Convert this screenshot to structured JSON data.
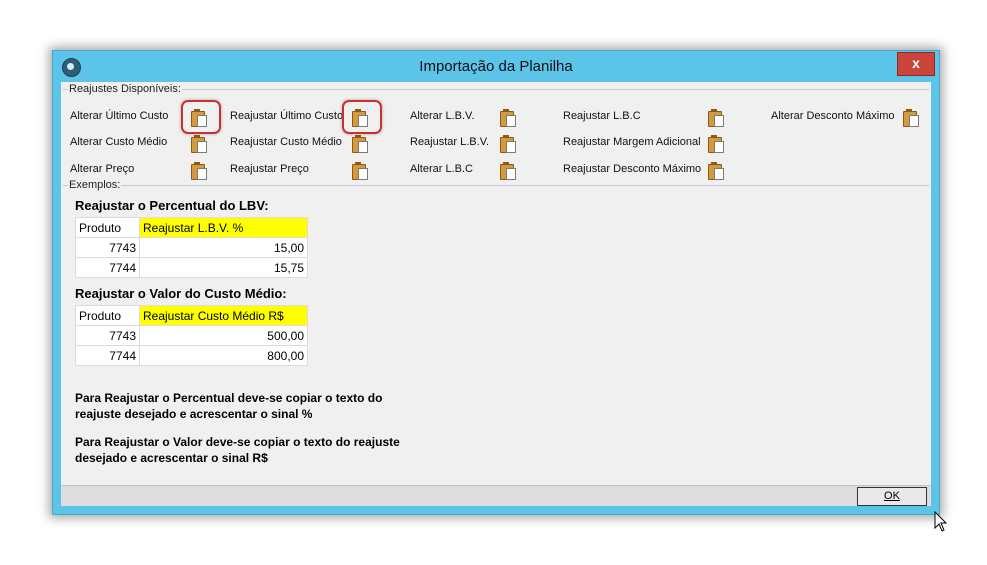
{
  "window": {
    "title": "Importação da Planilha",
    "close_label": "x"
  },
  "reajustes": {
    "legend": "Reajustes Disponíveis:",
    "items": [
      [
        "Alterar Último Custo",
        "Reajustar Último Custo",
        "Alterar L.B.V.",
        "Reajustar L.B.C",
        "Alterar Desconto Máximo"
      ],
      [
        "Alterar Custo Médio",
        "Reajustar Custo Médio",
        "Reajustar L.B.V.",
        "Reajustar Margem Adicional"
      ],
      [
        "Alterar Preço",
        "Reajustar Preço",
        "Alterar L.B.C",
        "Reajustar Desconto Máximo"
      ]
    ]
  },
  "exemplos": {
    "legend": "Exemplos:",
    "example1": {
      "heading": "Reajustar o Percentual do LBV:",
      "header": [
        "Produto",
        "Reajustar L.B.V. %"
      ],
      "rows": [
        [
          "7743",
          "15,00"
        ],
        [
          "7744",
          "15,75"
        ]
      ]
    },
    "example2": {
      "heading": "Reajustar o Valor do Custo Médio:",
      "header": [
        "Produto",
        "Reajustar Custo Médio R$"
      ],
      "rows": [
        [
          "7743",
          "500,00"
        ],
        [
          "7744",
          "800,00"
        ]
      ]
    },
    "note1": "Para Reajustar o Percentual deve-se copiar o texto do reajuste desejado e acrescentar o sinal %",
    "note2": "Para Reajustar o Valor deve-se copiar o texto do reajuste desejado e acrescentar o sinal R$"
  },
  "footer": {
    "ok_label": "OK"
  },
  "colors": {
    "titlebar": "#5bc4e8",
    "highlight": "#ffff00",
    "close": "#c9453b",
    "annotation": "#cc2f2f"
  },
  "icons": {
    "copy": "clipboard-copy-icon",
    "app": "app-icon"
  }
}
